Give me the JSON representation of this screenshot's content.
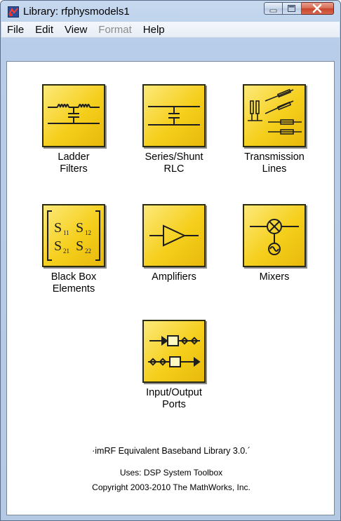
{
  "window": {
    "title": "Library: rfphysmodels1"
  },
  "menu": {
    "items": [
      {
        "label": "File",
        "enabled": true
      },
      {
        "label": "Edit",
        "enabled": true
      },
      {
        "label": "View",
        "enabled": true
      },
      {
        "label": "Format",
        "enabled": false
      },
      {
        "label": "Help",
        "enabled": true
      }
    ]
  },
  "blocks": [
    {
      "id": "ladder",
      "icon": "ladder-filter-icon",
      "line1": "Ladder",
      "line2": "Filters"
    },
    {
      "id": "series",
      "icon": "series-shunt-rlc-icon",
      "line1": "Series/Shunt",
      "line2": "RLC"
    },
    {
      "id": "tline",
      "icon": "transmission-lines-icon",
      "line1": "Transmission",
      "line2": "Lines"
    },
    {
      "id": "blackbox",
      "icon": "s-parameters-icon",
      "line1": "Black Box",
      "line2": "Elements",
      "matrix": [
        "S",
        "11",
        "S",
        "12",
        "S",
        "21",
        "S",
        "22"
      ]
    },
    {
      "id": "amp",
      "icon": "amplifier-icon",
      "line1": "Amplifiers",
      "line2": ""
    },
    {
      "id": "mixer",
      "icon": "mixer-icon",
      "line1": "Mixers",
      "line2": ""
    },
    {
      "id": "ports",
      "icon": "input-output-ports-icon",
      "line1": "Input/Output",
      "line2": "Ports"
    }
  ],
  "footer": {
    "library_name": "·imRF Equivalent Baseband Library 3.0.´",
    "uses": "Uses: DSP System Toolbox",
    "copyright": "Copyright 2003-2010 The MathWorks, Inc."
  },
  "colors": {
    "block_fill": "#f5cf1c",
    "title_gradient": "#c7d9ef",
    "close_button": "#c8432a"
  }
}
